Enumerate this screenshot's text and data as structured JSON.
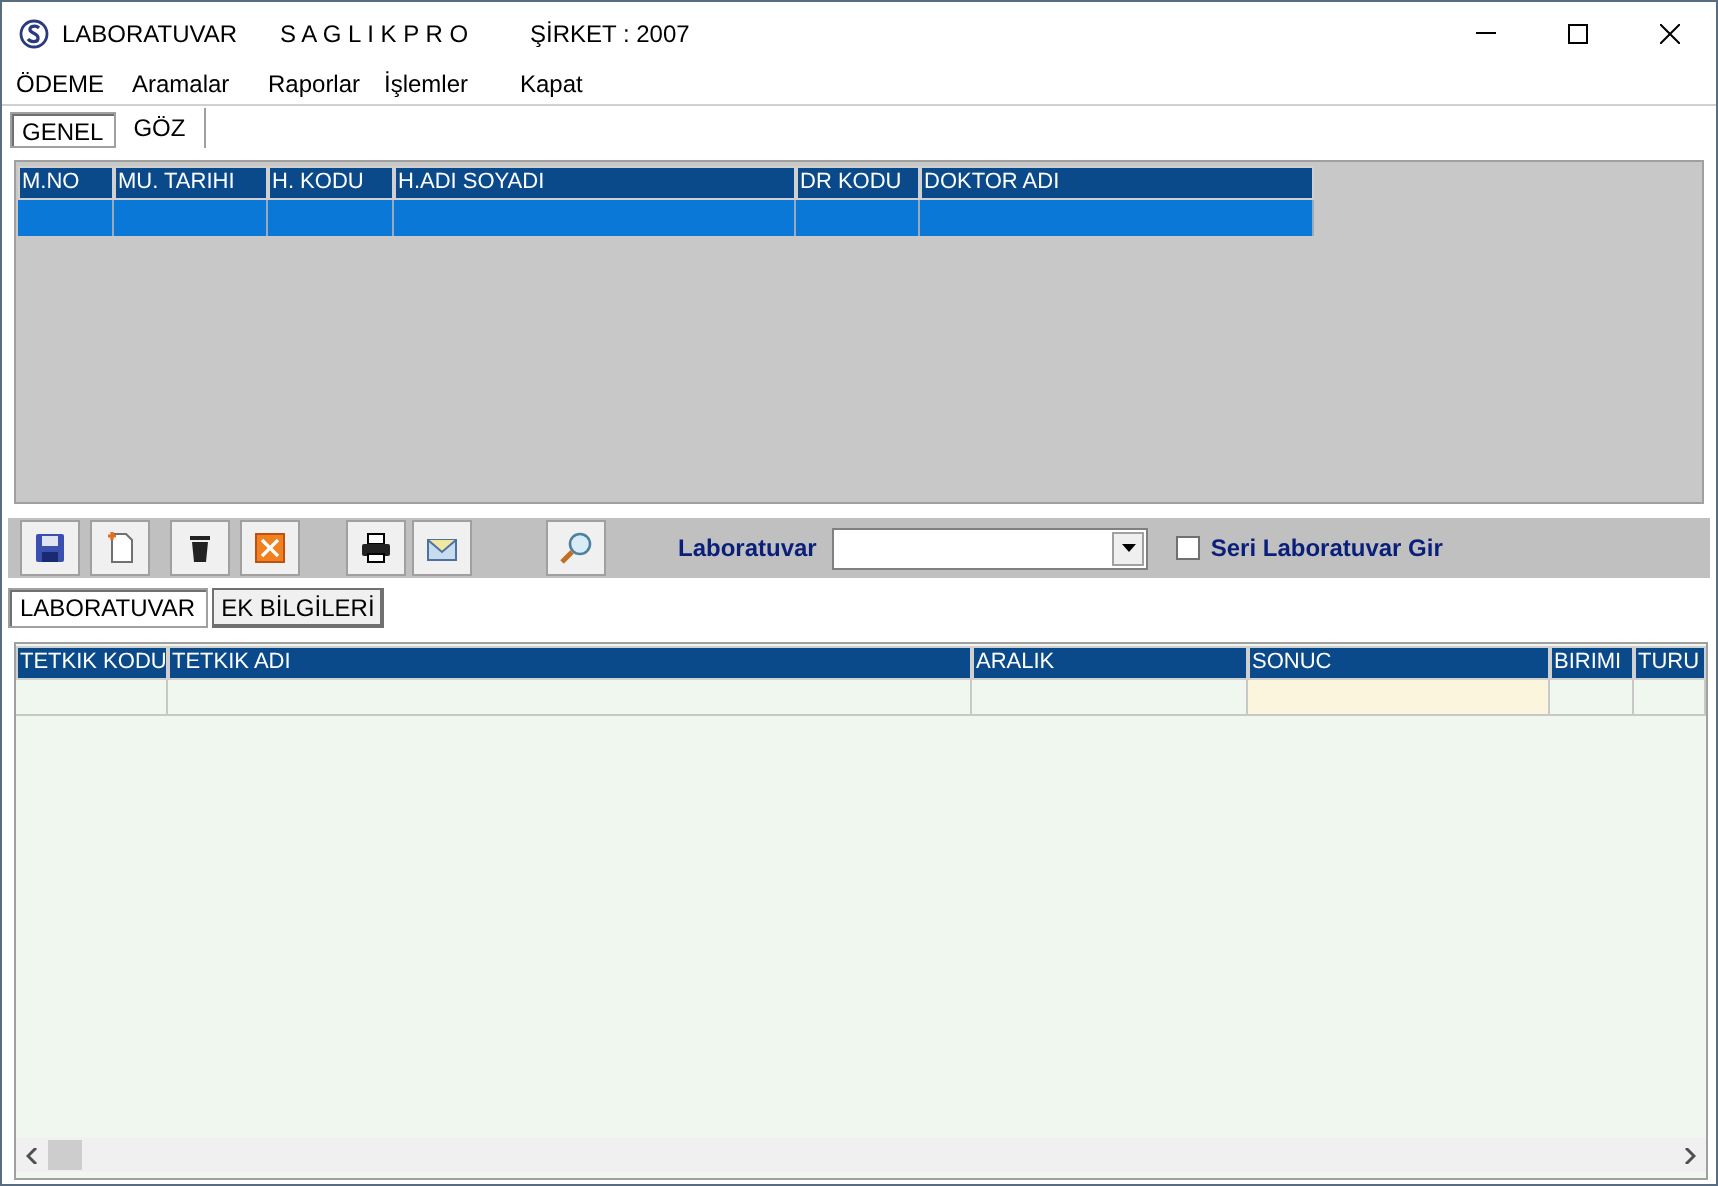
{
  "window": {
    "title": "LABORATUVAR",
    "brand": "S A G L I K P R O",
    "company": "ŞİRKET : 2007"
  },
  "menu": [
    "ÖDEME",
    "Aramalar",
    "Raporlar",
    "İşlemler",
    "Kapat"
  ],
  "tabs": [
    {
      "label": "GENEL",
      "selected": true
    },
    {
      "label": "GÖZ",
      "selected": false
    }
  ],
  "visit_table": {
    "columns": [
      "M.NO",
      "MU. TARIHI",
      "H. KODU",
      "H.ADI SOYADI",
      "DR KODU",
      "DOKTOR ADI"
    ],
    "rows": [
      {
        "selected": true
      }
    ]
  },
  "toolbar": [
    {
      "kind": "save"
    },
    {
      "kind": "new"
    },
    {
      "kind": "delete"
    },
    {
      "kind": "cancel"
    },
    {
      "kind": "print"
    },
    {
      "kind": "mail"
    },
    {
      "kind": "search"
    }
  ],
  "lab_field": {
    "label": "Laboratuvar"
  },
  "serial_checkbox": {
    "label": "Seri Laboratuvar Gir",
    "checked": false
  },
  "sub_tabs": [
    {
      "label": "LABORATUVAR",
      "selected": true
    },
    {
      "label": "EK BİLGİLERİ",
      "selected": false
    }
  ],
  "test_table": {
    "columns": [
      {
        "label": "TETKIK KODU",
        "editable": false
      },
      {
        "label": "TETKIK ADI",
        "editable": false
      },
      {
        "label": "ARALIK",
        "editable": false
      },
      {
        "label": "SONUC",
        "editable": true
      },
      {
        "label": "BIRIMI",
        "editable": false
      },
      {
        "label": "TURU",
        "editable": false
      }
    ]
  }
}
